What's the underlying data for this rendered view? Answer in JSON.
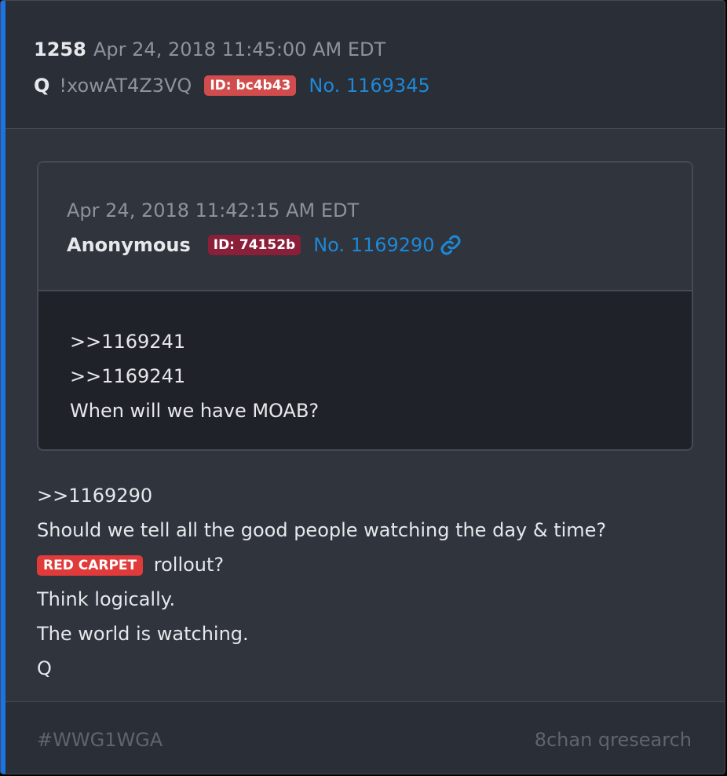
{
  "post": {
    "number": "1258",
    "date": "Apr 24, 2018 11:45:00 AM EDT",
    "author": "Q",
    "tripcode": "!xowAT4Z3VQ",
    "id_badge": "ID: bc4b43",
    "post_no": "No. 1169345",
    "body_lines": [
      ">>1169290",
      "Should we tell all the good people watching the day & time?"
    ],
    "red_tag": "RED CARPET",
    "red_tag_suffix": " rollout?",
    "body_lines_after": [
      "Think logically.",
      "The world is watching.",
      "Q"
    ]
  },
  "quoted": {
    "date": "Apr 24, 2018 11:42:15 AM EDT",
    "author": "Anonymous",
    "id_badge": "ID: 74152b",
    "post_no": "No. 1169290",
    "link_icon": "link-icon",
    "body_lines": [
      ">>1169241",
      ">>1169241",
      "When will we have MOAB?"
    ]
  },
  "footer": {
    "hashtag": "#WWG1WGA",
    "source": "8chan qresearch"
  },
  "colors": {
    "accent": "#1a73e8",
    "link": "#1e88d6",
    "q_id_badge": "#d14c4c",
    "anon_id_badge": "#8a1f3a",
    "red_tag": "#e03a3a"
  }
}
